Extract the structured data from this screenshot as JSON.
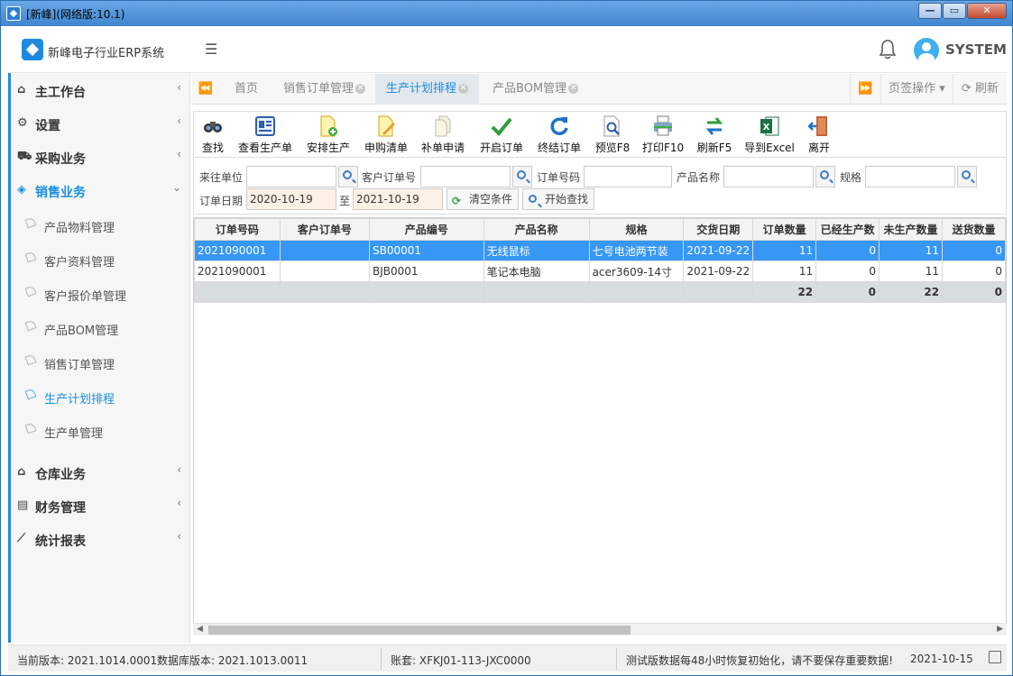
{
  "window": {
    "title": "[新峰](网络版:10.1)"
  },
  "header": {
    "app_name": "新峰电子行业ERP系统",
    "user": "SYSTEM"
  },
  "sidebar": {
    "top_items": [
      {
        "label": "主工作台",
        "icon": "home-icon"
      },
      {
        "label": "设置",
        "icon": "gear-icon"
      },
      {
        "label": "采购业务",
        "icon": "cart-icon"
      },
      {
        "label": "销售业务",
        "icon": "tag-icon"
      }
    ],
    "sub_items": [
      {
        "label": "产品物料管理"
      },
      {
        "label": "客户资料管理"
      },
      {
        "label": "客户报价单管理"
      },
      {
        "label": "产品BOM管理"
      },
      {
        "label": "销售订单管理"
      },
      {
        "label": "生产计划排程"
      },
      {
        "label": "生产单管理"
      }
    ],
    "bottom_items": [
      {
        "label": "仓库业务",
        "icon": "warehouse-icon"
      },
      {
        "label": "财务管理",
        "icon": "finance-icon"
      },
      {
        "label": "统计报表",
        "icon": "chart-icon"
      }
    ]
  },
  "tabs": {
    "items": [
      {
        "label": "首页"
      },
      {
        "label": "销售订单管理"
      },
      {
        "label": "生产计划排程"
      },
      {
        "label": "产品BOM管理"
      }
    ],
    "page_ops": "页签操作",
    "refresh": "刷新"
  },
  "toolbar": {
    "buttons": [
      {
        "label": "查找",
        "icon": "binoculars-icon"
      },
      {
        "label": "查看生产单",
        "icon": "view-doc-icon"
      },
      {
        "label": "安排生产",
        "icon": "add-doc-icon"
      },
      {
        "label": "申购清单",
        "icon": "edit-doc-icon"
      },
      {
        "label": "补单申请",
        "icon": "copy-doc-icon"
      },
      {
        "label": "开启订单",
        "icon": "check-icon"
      },
      {
        "label": "终结订单",
        "icon": "refresh-icon"
      },
      {
        "label": "预览F8",
        "icon": "preview-icon"
      },
      {
        "label": "打印F10",
        "icon": "printer-icon"
      },
      {
        "label": "刷新F5",
        "icon": "swap-arrows-icon"
      },
      {
        "label": "导到Excel",
        "icon": "excel-icon"
      },
      {
        "label": "离开",
        "icon": "exit-door-icon"
      }
    ]
  },
  "filters": {
    "supplier_label": "来往单位",
    "customer_order_label": "客户订单号",
    "order_no_label": "订单号码",
    "product_name_label": "产品名称",
    "spec_label": "规格",
    "date_label": "订单日期",
    "date_from": "2020-10-19",
    "date_to_label": "至",
    "date_to": "2021-10-19",
    "clear_label": "清空条件",
    "search_label": "开始查找"
  },
  "grid": {
    "columns": [
      "订单号码",
      "客户订单号",
      "产品编号",
      "产品名称",
      "规格",
      "交货日期",
      "订单数量",
      "已经生产数",
      "未生产数量",
      "送货数量"
    ],
    "rows": [
      [
        "2021090001",
        "",
        "SB00001",
        "无线鼠标",
        "七号电池两节装",
        "2021-09-22",
        "11",
        "0",
        "11",
        "0"
      ],
      [
        "2021090001",
        "",
        "BJB0001",
        "笔记本电脑",
        "acer3609-14寸",
        "2021-09-22",
        "11",
        "0",
        "11",
        "0"
      ]
    ],
    "totals": [
      "",
      "",
      "",
      "",
      "",
      "",
      "22",
      "0",
      "22",
      "0"
    ]
  },
  "status": {
    "version": "当前版本: 2021.1014.0001",
    "db_version": "数据库版本: 2021.1013.0011",
    "account": "账套: XFKJ01-113-JXC0000",
    "notice": "测试版数据每48小时恢复初始化，请不要保存重要数据!",
    "date": "2021-10-15"
  },
  "colors": {
    "accent": "#1a8ee0",
    "selected_row": "#3797f5",
    "totals_row": "#d8dee0"
  }
}
